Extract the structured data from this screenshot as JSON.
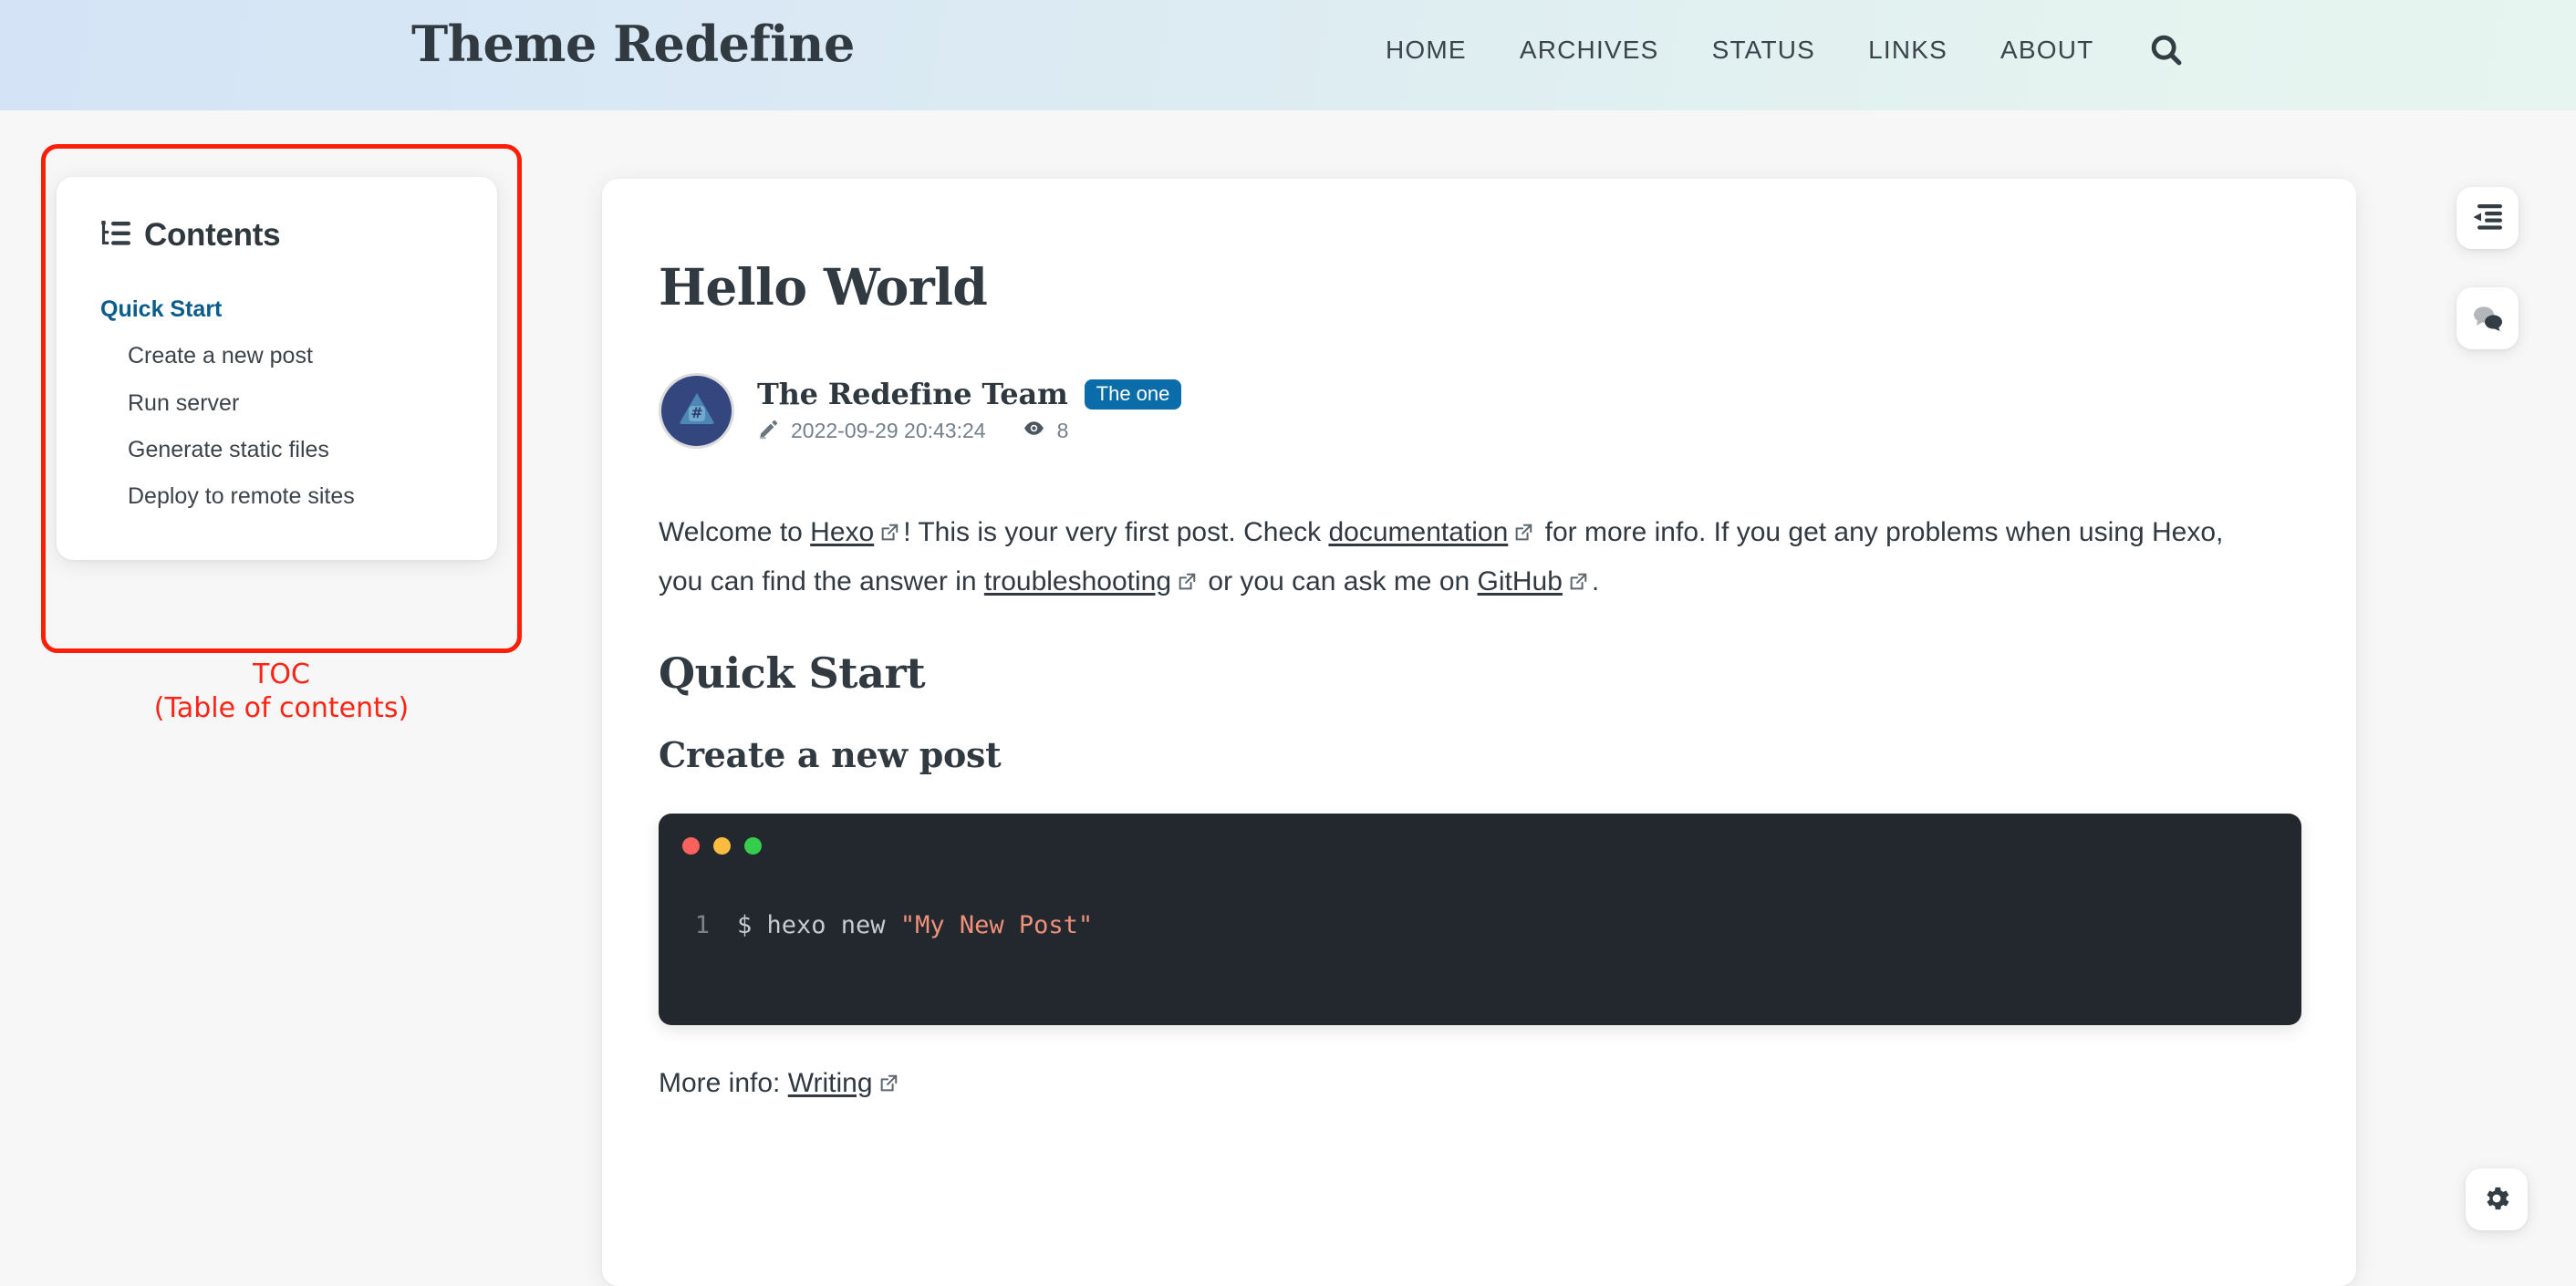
{
  "header": {
    "site_title": "Theme Redefine",
    "nav": [
      {
        "label": "HOME"
      },
      {
        "label": "ARCHIVES"
      },
      {
        "label": "STATUS"
      },
      {
        "label": "LINKS"
      },
      {
        "label": "ABOUT"
      }
    ],
    "search_icon": "search-icon",
    "gradient_from": "#d4e4f6",
    "gradient_to": "#e7f5f0"
  },
  "toc": {
    "icon": "list-tree-icon",
    "title": "Contents",
    "items": [
      {
        "label": "Quick Start",
        "level": 1,
        "active": true
      },
      {
        "label": "Create a new post",
        "level": 2,
        "active": false
      },
      {
        "label": "Run server",
        "level": 2,
        "active": false
      },
      {
        "label": "Generate static files",
        "level": 2,
        "active": false
      },
      {
        "label": "Deploy to remote sites",
        "level": 2,
        "active": false
      }
    ],
    "active_color": "#0a5c8c"
  },
  "annotation": {
    "line1": "TOC",
    "line2": "(Table of contents)",
    "color": "#fd2315"
  },
  "article": {
    "title": "Hello World",
    "author": "The Redefine Team",
    "badge": "The one",
    "badge_color": "#0a6ca8",
    "date_icon": "pencil-icon",
    "date": "2022-09-29 20:43:24",
    "views_icon": "eye-icon",
    "views": "8",
    "avatar_icon": "hash-triangle-avatar",
    "paragraph": {
      "t1": "Welcome to ",
      "link1": "Hexo",
      "t2": "! This is your very first post. Check ",
      "link2": "documentation",
      "t3": " for more info. If you get any problems when using Hexo, you can find the answer in ",
      "link3": "troubleshooting",
      "t4": " or you can ask me on ",
      "link4": "GitHub",
      "t5": "."
    },
    "heading_quick_start": "Quick Start",
    "heading_create_post": "Create a new post",
    "code": {
      "line_number": "1",
      "prompt": "$ hexo new ",
      "string": "\"My New Post\"",
      "bg": "#23272e",
      "dots": [
        "#fc625d",
        "#fdbc40",
        "#35cd4b"
      ]
    },
    "more_info_prefix": "More info: ",
    "more_info_link": "Writing"
  },
  "floating": {
    "toc_toggle": "text-indent-icon",
    "comments": "comments-icon",
    "settings": "gear-icon"
  }
}
